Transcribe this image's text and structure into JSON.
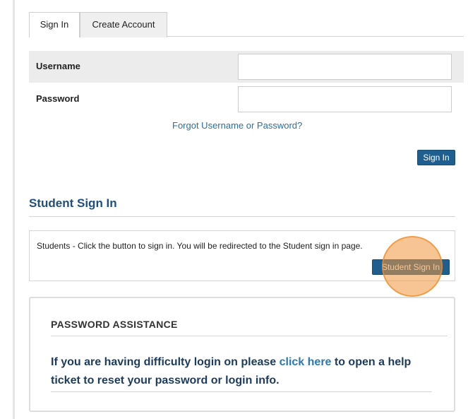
{
  "tabs": [
    {
      "label": "Sign In",
      "active": true
    },
    {
      "label": "Create Account",
      "active": false
    }
  ],
  "form": {
    "username_label": "Username",
    "username_value": "",
    "password_label": "Password",
    "password_value": "",
    "forgot_link": "Forgot Username or Password?",
    "signin_button": "Sign In"
  },
  "student": {
    "title": "Student Sign In",
    "message": "Students - Click the button to sign in. You will be redirected to the Student sign in page.",
    "button": "Student Sign In"
  },
  "assistance": {
    "title": "PASSWORD ASSISTANCE",
    "text_before": "If you are having difficulty login on please ",
    "link_text": "click here",
    "text_after": " to open a help ticket to reset your password or login info."
  },
  "colors": {
    "brand_button": "#1f5f8f",
    "heading_blue": "#1f4f7f",
    "link_blue": "#2c6e9e",
    "highlight_orange": "#f0963c"
  }
}
